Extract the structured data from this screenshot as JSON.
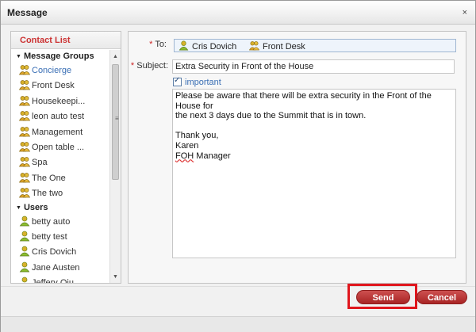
{
  "dialog": {
    "title": "Message",
    "close_label": "×"
  },
  "contacts": {
    "header": "Contact List",
    "groups_label": "Message Groups",
    "groups": [
      {
        "label": "Concierge",
        "selected": true
      },
      {
        "label": "Front Desk"
      },
      {
        "label": "Housekeepi..."
      },
      {
        "label": "leon auto test"
      },
      {
        "label": "Management"
      },
      {
        "label": "Open table ..."
      },
      {
        "label": "Spa"
      },
      {
        "label": "The One"
      },
      {
        "label": "The two"
      }
    ],
    "users_label": "Users",
    "users": [
      {
        "label": "betty auto"
      },
      {
        "label": "betty test"
      },
      {
        "label": "Cris Dovich"
      },
      {
        "label": "Jane Austen"
      },
      {
        "label": "Jeffery Qiu"
      }
    ]
  },
  "compose": {
    "to_label": "To:",
    "subject_label": "Subject:",
    "required_marker": "*",
    "recipients": [
      {
        "label": "Cris Dovich",
        "kind": "user"
      },
      {
        "label": "Front Desk",
        "kind": "group"
      }
    ],
    "subject_value": "Extra Security in Front of the House",
    "important_label": "important",
    "important_checked": true,
    "body_line1": "Please be aware that there will be extra security in the Front of the House for",
    "body_line2": "the next 3 days due to the Summit that is in town.",
    "body_line3": "Thank you,",
    "body_line4": "Karen",
    "body_sig_abbr": "FOH",
    "body_sig_rest": " Manager"
  },
  "buttons": {
    "send_label": "Send",
    "cancel_label": "Cancel"
  },
  "colors": {
    "accent_red": "#cd3b3b",
    "link_blue": "#3a6fb5",
    "highlight_red": "#e0161d"
  }
}
